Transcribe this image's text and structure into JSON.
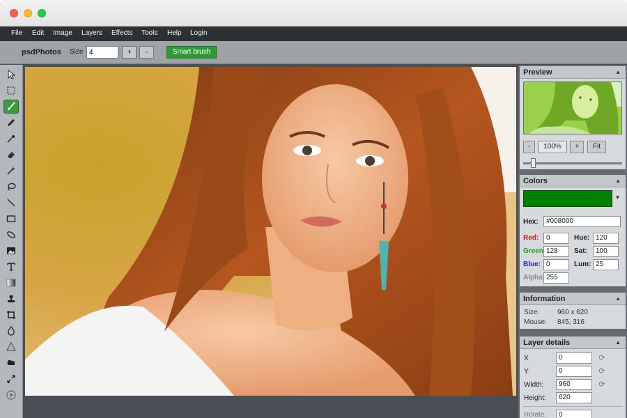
{
  "menu": [
    "File",
    "Edit",
    "Image",
    "Layers",
    "Effects",
    "Tools",
    "Help",
    "Login"
  ],
  "toolbar": {
    "brand": "psdPhotos",
    "size_label": "Size",
    "size_value": "4",
    "plus_label": "+",
    "minus_label": "-",
    "smart_brush_label": "Smart brush"
  },
  "tools": [
    "pointer-icon",
    "marquee-select-icon",
    "smart-brush-icon",
    "pencil-icon",
    "eyedropper-icon",
    "eraser-icon",
    "magic-wand-icon",
    "lasso-icon",
    "line-icon",
    "rectangle-icon",
    "ellipse-icon",
    "image-icon",
    "text-icon",
    "gradient-icon",
    "stamp-icon",
    "crop-icon",
    "blur-drop-icon",
    "sharpen-icon",
    "smudge-icon",
    "resize-icon",
    "play-icon"
  ],
  "active_tool": "smart-brush-icon",
  "preview": {
    "title": "Preview",
    "zoom_out_label": "-",
    "zoom_value": "100%",
    "zoom_in_label": "+",
    "fit_label": "Fit",
    "zoom_slider_fraction": 0.08
  },
  "colors": {
    "title": "Colors",
    "swatch": "#008000",
    "hex_label": "Hex:",
    "hex_value": "#008000",
    "red_label": "Red:",
    "red_value": "0",
    "green_label": "Green:",
    "green_value": "128",
    "blue_label": "Blue:",
    "blue_value": "0",
    "alpha_label": "Alpha:",
    "alpha_value": "255",
    "hue_label": "Hue:",
    "hue_value": "120",
    "sat_label": "Sat:",
    "sat_value": "100",
    "lum_label": "Lum:",
    "lum_value": "25"
  },
  "information": {
    "title": "Information",
    "size_label": "Size:",
    "size_value": "960 x 620",
    "mouse_label": "Mouse:",
    "mouse_value": "845, 316"
  },
  "layer_details": {
    "title": "Layer details",
    "x_label": "X",
    "x_value": "0",
    "y_label": "Y:",
    "y_value": "0",
    "width_label": "Width:",
    "width_value": "960",
    "height_label": "Height:",
    "height_value": "620",
    "rotate_label": "Rotate:",
    "rotate_value": "0"
  },
  "theme": {
    "accent": "#2e9a3a",
    "panel_bg": "#d7dadd",
    "menubar_bg": "#2e3134"
  }
}
